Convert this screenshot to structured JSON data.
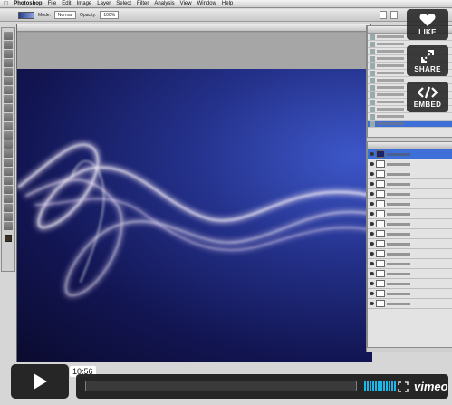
{
  "menubar": {
    "items": [
      "Photoshop",
      "File",
      "Edit",
      "Image",
      "Layer",
      "Select",
      "Filter",
      "Analysis",
      "View",
      "Window",
      "Help"
    ]
  },
  "options_bar": {
    "mode_label": "Mode:",
    "mode_value": "Normal",
    "opacity_label": "Opacity:",
    "opacity_value": "100%"
  },
  "overlay": {
    "like_label": "LIKE",
    "share_label": "SHARE",
    "embed_label": "EMBED"
  },
  "player": {
    "timecode": "10:56",
    "progress": 0.0,
    "volume_level": 1.0,
    "logo_text": "vimeo"
  },
  "colors": {
    "overlay_bg": "#232323",
    "volume_accent": "#19b7ea",
    "canvas_deep": "#0b0b2e",
    "canvas_bright": "#3d57c9"
  },
  "icons": [
    "heart-icon",
    "share-icon",
    "embed-code-icon",
    "play-icon",
    "fullscreen-icon"
  ]
}
